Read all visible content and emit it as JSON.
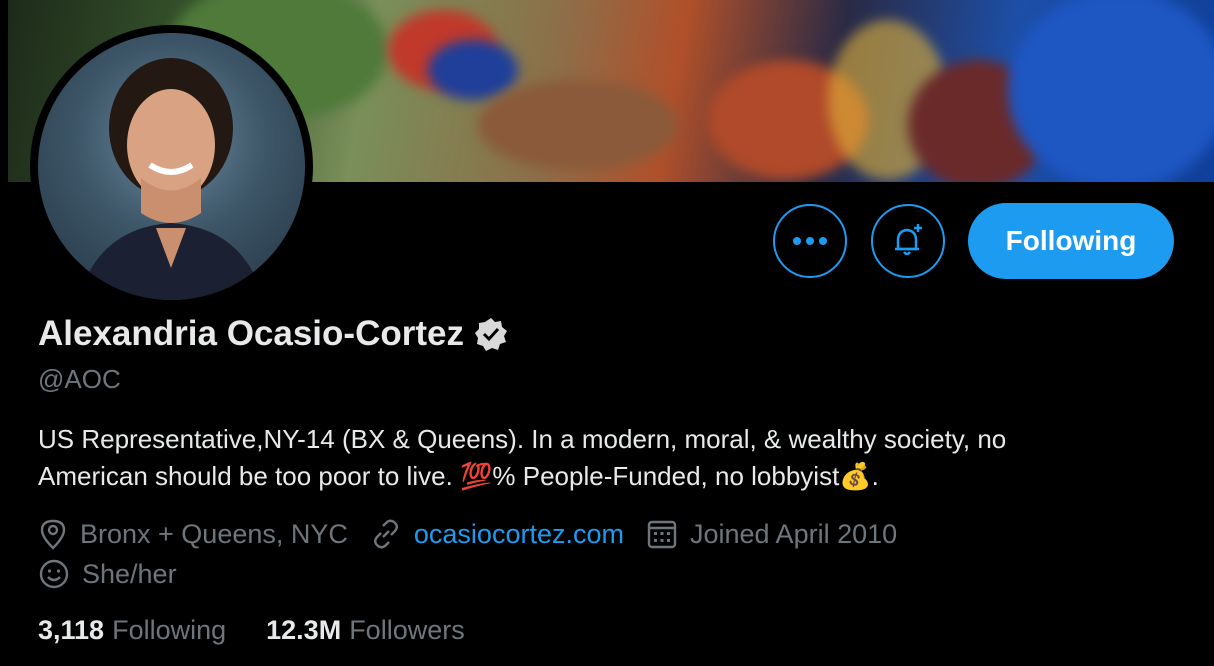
{
  "profile": {
    "name": "Alexandria Ocasio-Cortez",
    "handle": "@AOC",
    "bio_line1": "US Representative,NY-14 (BX & Queens). In a modern, moral, & wealthy society, no",
    "bio_line2_a": "American should be too poor to live. ",
    "bio_emoji_100": "💯",
    "bio_line2_b": "% People-Funded, no lobbyist",
    "bio_emoji_money": "💰",
    "bio_line2_c": ".",
    "location": "Bronx + Queens, NYC",
    "website": "ocasiocortez.com",
    "joined": "Joined April 2010",
    "pronouns": "She/her"
  },
  "stats": {
    "following_count": "3,118",
    "following_label": "Following",
    "followers_count": "12.3M",
    "followers_label": "Followers"
  },
  "actions": {
    "follow_label": "Following"
  },
  "icons": {
    "more": "more-horizontal-icon",
    "notify": "bell-plus-icon",
    "verified": "verified-badge-icon",
    "location": "location-pin-icon",
    "link": "link-icon",
    "calendar": "calendar-icon",
    "pronouns": "smiley-icon"
  },
  "colors": {
    "accent": "#1d9bf0",
    "background": "#000000",
    "secondary_text": "#6e767d"
  }
}
